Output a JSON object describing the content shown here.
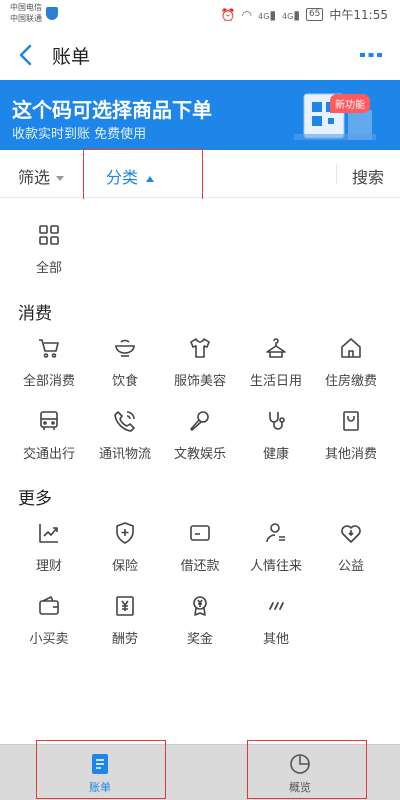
{
  "status_bar": {
    "carrier_1": "中国电信",
    "carrier_2": "中国联通",
    "signal_1": "4G",
    "signal_2": "4G",
    "battery": "65",
    "time": "中午11:55"
  },
  "header": {
    "title": "账单",
    "back_icon": "chevron-left-icon",
    "more_icon": "more-dots-icon"
  },
  "banner": {
    "title": "这个码可选择商品下单",
    "subtitle": "收款实时到账  免费使用",
    "badge": "新功能"
  },
  "filter_bar": {
    "filter_label": "筛选",
    "category_label": "分类",
    "search_label": "搜索"
  },
  "categories": {
    "all": {
      "label": "全部",
      "icon": "grid-icon"
    },
    "consume_title": "消费",
    "consume": [
      {
        "label": "全部消费",
        "icon": "cart-icon"
      },
      {
        "label": "饮食",
        "icon": "bowl-icon"
      },
      {
        "label": "服饰美容",
        "icon": "shirt-icon"
      },
      {
        "label": "生活日用",
        "icon": "hanger-icon"
      },
      {
        "label": "住房缴费",
        "icon": "house-icon"
      },
      {
        "label": "交通出行",
        "icon": "bus-icon"
      },
      {
        "label": "通讯物流",
        "icon": "phone-icon"
      },
      {
        "label": "文教娱乐",
        "icon": "microphone-icon"
      },
      {
        "label": "健康",
        "icon": "stethoscope-icon"
      },
      {
        "label": "其他消费",
        "icon": "bag-icon"
      }
    ],
    "more_title": "更多",
    "more": [
      {
        "label": "理财",
        "icon": "chart-icon"
      },
      {
        "label": "保险",
        "icon": "shield-plus-icon"
      },
      {
        "label": "借还款",
        "icon": "card-icon"
      },
      {
        "label": "人情往来",
        "icon": "person-icon"
      },
      {
        "label": "公益",
        "icon": "heart-icon"
      },
      {
        "label": "小买卖",
        "icon": "wallet-icon"
      },
      {
        "label": "酬劳",
        "icon": "yen-doc-icon"
      },
      {
        "label": "奖金",
        "icon": "medal-icon"
      },
      {
        "label": "其他",
        "icon": "slashes-icon"
      }
    ]
  },
  "tab_bar": {
    "tabs": [
      {
        "label": "账单",
        "icon": "bill-icon",
        "active": true
      },
      {
        "label": "概览",
        "icon": "pie-chart-icon",
        "active": false
      }
    ]
  },
  "colors": {
    "accent": "#1d86e8",
    "highlight_box": "#e53935",
    "badge": "#ff5a5f"
  }
}
